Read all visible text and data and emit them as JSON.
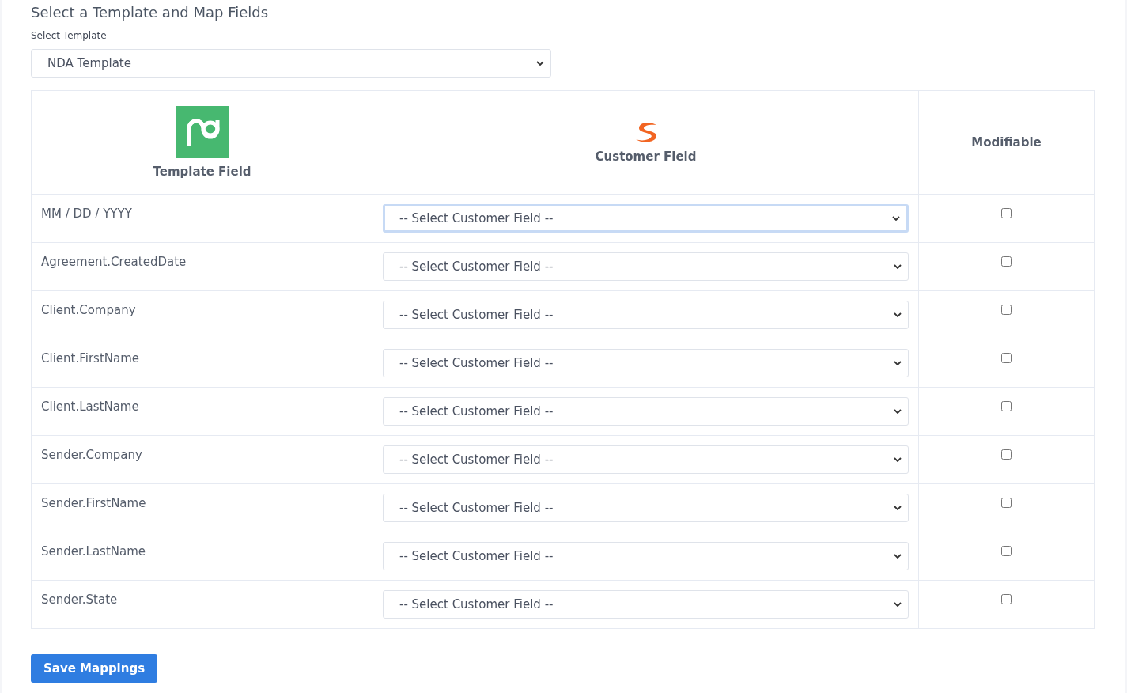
{
  "title": "Select a Template and Map Fields",
  "template_select": {
    "label": "Select Template",
    "value": "NDA Template"
  },
  "table": {
    "columns": [
      "Template Field",
      "Customer Field",
      "Modifiable"
    ],
    "rows": [
      {
        "template_field": "MM / DD / YYYY",
        "customer_field": "-- Select Customer Field --",
        "focused": true,
        "modifiable": false
      },
      {
        "template_field": "Agreement.CreatedDate",
        "customer_field": "-- Select Customer Field --",
        "focused": false,
        "modifiable": false
      },
      {
        "template_field": "Client.Company",
        "customer_field": "-- Select Customer Field --",
        "focused": false,
        "modifiable": false
      },
      {
        "template_field": "Client.FirstName",
        "customer_field": "-- Select Customer Field --",
        "focused": false,
        "modifiable": false
      },
      {
        "template_field": "Client.LastName",
        "customer_field": "-- Select Customer Field --",
        "focused": false,
        "modifiable": false
      },
      {
        "template_field": "Sender.Company",
        "customer_field": "-- Select Customer Field --",
        "focused": false,
        "modifiable": false
      },
      {
        "template_field": "Sender.FirstName",
        "customer_field": "-- Select Customer Field --",
        "focused": false,
        "modifiable": false
      },
      {
        "template_field": "Sender.LastName",
        "customer_field": "-- Select Customer Field --",
        "focused": false,
        "modifiable": false
      },
      {
        "template_field": "Sender.State",
        "customer_field": "-- Select Customer Field --",
        "focused": false,
        "modifiable": false
      }
    ]
  },
  "save_button": "Save Mappings"
}
